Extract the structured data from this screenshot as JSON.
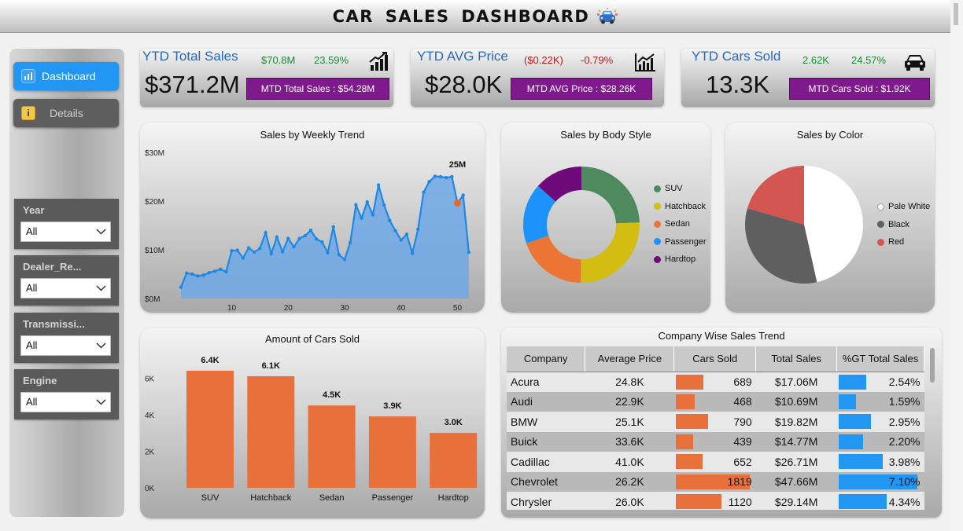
{
  "header": {
    "title": "CAR  SALES  DASHBOARD"
  },
  "nav": {
    "dashboard": "Dashboard",
    "details": "Details"
  },
  "filters": [
    {
      "label": "Year",
      "value": "All"
    },
    {
      "label": "Dealer_Re...",
      "value": "All"
    },
    {
      "label": "Transmissi...",
      "value": "All"
    },
    {
      "label": "Engine",
      "value": "All"
    }
  ],
  "kpis": [
    {
      "title": "YTD Total Sales",
      "delta_value": "$70.8M",
      "delta_pct": "23.59%",
      "value": "$371.2M",
      "mtd": "MTD Total Sales : $54.28M"
    },
    {
      "title": "YTD AVG Price",
      "delta_value": "($0.22K)",
      "delta_pct": "-0.79%",
      "value": "$28.0K",
      "mtd": "MTD AVG Price : $28.26K"
    },
    {
      "title": "YTD Cars Sold",
      "delta_value": "2.62K",
      "delta_pct": "24.57%",
      "value": "13.3K",
      "mtd": "MTD Cars Sold : $1.92K"
    }
  ],
  "colors": {
    "accent": "#2196f3",
    "purple": "#7e1a8c",
    "orange": "#e8703a",
    "green": "#1b8a3a",
    "red": "#b11d1d",
    "area": "#6fa8e6",
    "line": "#1e88e5",
    "peak": "#f0662a"
  },
  "charts": {
    "weekly_title": "Sales by Weekly Trend",
    "body_title": "Sales by Body Style",
    "color_title": "Sales by Color",
    "sold_title": "Amount of Cars Sold",
    "company_title": "Company Wise Sales Trend"
  },
  "chart_data": [
    {
      "type": "area",
      "title": "Sales by Weekly Trend",
      "x": [
        1,
        2,
        3,
        4,
        5,
        6,
        7,
        8,
        9,
        10,
        11,
        12,
        13,
        14,
        15,
        16,
        17,
        18,
        19,
        20,
        21,
        22,
        23,
        24,
        25,
        26,
        27,
        28,
        29,
        30,
        31,
        32,
        33,
        34,
        35,
        36,
        37,
        38,
        39,
        40,
        41,
        42,
        43,
        44,
        45,
        46,
        47,
        48,
        49,
        50,
        51,
        52,
        53
      ],
      "values": [
        2.3,
        5.2,
        5.0,
        4.6,
        4.8,
        5.3,
        5.6,
        6.0,
        5.5,
        9.8,
        9.9,
        8.3,
        10.4,
        9.5,
        10.3,
        13.5,
        9.2,
        12.6,
        9.6,
        12.3,
        10.6,
        12.3,
        12.9,
        14.0,
        12.2,
        11.6,
        9.4,
        14.7,
        9.0,
        8.0,
        11.5,
        19.2,
        16.5,
        19.8,
        17.2,
        23.3,
        19.2,
        16.0,
        13.9,
        12.0,
        13.2,
        9.3,
        14.2,
        21.8,
        24.0,
        25.1,
        25.0,
        24.8,
        25.0,
        19.6,
        21.2,
        9.5
      ],
      "peak": {
        "x": 50,
        "value": 25.0,
        "label": "25M"
      },
      "xticks": [
        "10",
        "20",
        "30",
        "40",
        "50"
      ],
      "yticks": [
        "$0M",
        "$10M",
        "$20M",
        "$30M"
      ],
      "ylim": [
        0,
        30
      ]
    },
    {
      "type": "pie",
      "title": "Sales by Body Style",
      "donut": true,
      "categories": [
        "SUV",
        "Hatchback",
        "Sedan",
        "Passenger",
        "Hardtop"
      ],
      "values": [
        24.4,
        25.8,
        19.6,
        16.8,
        13.4
      ],
      "colors": [
        "#4f8a5f",
        "#d3bd12",
        "#ec7434",
        "#1b93fb",
        "#6e0a79"
      ]
    },
    {
      "type": "pie",
      "title": "Sales by Color",
      "categories": [
        "Pale White",
        "Black",
        "Red"
      ],
      "values": [
        46.5,
        33.0,
        20.5
      ],
      "colors": [
        "#ffffff",
        "#5f5f5f",
        "#d35750"
      ]
    },
    {
      "type": "bar",
      "title": "Amount of Cars Sold",
      "categories": [
        "SUV",
        "Hatchback",
        "Sedan",
        "Passenger",
        "Hardtop"
      ],
      "values": [
        6.4,
        6.1,
        4.5,
        3.9,
        3.0
      ],
      "labels": [
        "6.4K",
        "6.1K",
        "4.5K",
        "3.9K",
        "3.0K"
      ],
      "yticks": [
        "0K",
        "2K",
        "4K",
        "6K"
      ],
      "ylim": [
        0,
        7
      ]
    },
    {
      "type": "table",
      "title": "Company Wise Sales Trend",
      "columns": [
        "Company",
        "Average Price",
        "Cars Sold",
        "Total Sales",
        "%GT Total Sales"
      ],
      "rows": [
        {
          "company": "Acura",
          "avg": "24.8K",
          "sold": "689",
          "sold_n": 689,
          "total": "$17.06M",
          "pct": "2.54%",
          "pct_n": 2.54
        },
        {
          "company": "Audi",
          "avg": "22.9K",
          "sold": "468",
          "sold_n": 468,
          "total": "$10.69M",
          "pct": "1.59%",
          "pct_n": 1.59
        },
        {
          "company": "BMW",
          "avg": "25.1K",
          "sold": "790",
          "sold_n": 790,
          "total": "$19.82M",
          "pct": "2.95%",
          "pct_n": 2.95
        },
        {
          "company": "Buick",
          "avg": "33.6K",
          "sold": "439",
          "sold_n": 439,
          "total": "$14.77M",
          "pct": "2.20%",
          "pct_n": 2.2
        },
        {
          "company": "Cadillac",
          "avg": "41.0K",
          "sold": "652",
          "sold_n": 652,
          "total": "$26.71M",
          "pct": "3.98%",
          "pct_n": 3.98
        },
        {
          "company": "Chevrolet",
          "avg": "26.2K",
          "sold": "1819",
          "sold_n": 1819,
          "total": "$47.66M",
          "pct": "7.10%",
          "pct_n": 7.1
        },
        {
          "company": "Chrysler",
          "avg": "26.0K",
          "sold": "1120",
          "sold_n": 1120,
          "total": "$29.14M",
          "pct": "4.34%",
          "pct_n": 4.34
        }
      ]
    }
  ]
}
